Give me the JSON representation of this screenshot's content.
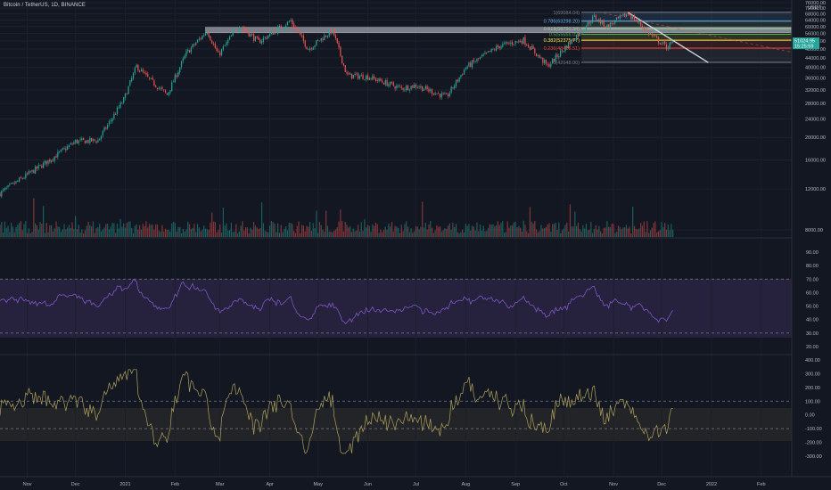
{
  "symbol_title": "Bitcoin / TetherUS, 1D, BINANCE",
  "currency": "USDT",
  "last_price": "51024.95",
  "countdown": "15:25:59",
  "colors": {
    "background": "#131722",
    "up": "#26a69a",
    "down": "#ef5350",
    "rsi": "#7e57c2",
    "cci": "#b0a15b",
    "fib_1": "#787b86",
    "fib_0786": "#64b5f6",
    "fib_0618": "#81c784",
    "fib_05": "#4caf50",
    "fib_0382": "#ffeb3b",
    "fib_0236": "#f44336",
    "fib_0": "#787b86",
    "resistance": "#787b86",
    "trendline": "#d1d4dc"
  },
  "fib_labels": [
    {
      "level": "1",
      "text": "1(69084.04)"
    },
    {
      "level": "0.786",
      "text": "0.786(63298.20)"
    },
    {
      "level": "0.618",
      "text": "0.618(58750.34)"
    },
    {
      "level": "0.5",
      "text": "0.5(55566.02)"
    },
    {
      "level": "0.382",
      "text": "0.382(52375.77)"
    },
    {
      "level": "0.236",
      "text": "0.236(48428.51)"
    },
    {
      "level": "0",
      "text": "0(42048.00)"
    }
  ],
  "chart_data": [
    {
      "type": "candlestick",
      "title": "Bitcoin / TetherUS, 1D, BINANCE",
      "ylabel": "USDT",
      "y_scale": "log",
      "y_ticks": [
        "76000.00",
        "72000.00",
        "68000.00",
        "64000.00",
        "60000.00",
        "56000.00",
        "52000.00",
        "48000.00",
        "44000.00",
        "40000.00",
        "36000.00",
        "32000.00",
        "28000.00",
        "24000.00",
        "20000.00",
        "16000.00",
        "12000.00",
        "8000.00"
      ],
      "x_ticks": [
        "Nov",
        "Dec",
        "2021",
        "Feb",
        "Mar",
        "Apr",
        "May",
        "Jun",
        "Jul",
        "Aug",
        "Sep",
        "Oct",
        "Nov",
        "Dec",
        "2022",
        "Feb"
      ],
      "x_range": [
        "2020-10-15",
        "2022-02-20"
      ],
      "close_series": [
        [
          "2020-10-15",
          11500
        ],
        [
          "2020-11-01",
          13800
        ],
        [
          "2020-11-15",
          16000
        ],
        [
          "2020-12-01",
          19200
        ],
        [
          "2020-12-15",
          19400
        ],
        [
          "2020-12-31",
          29000
        ],
        [
          "2021-01-08",
          40500
        ],
        [
          "2021-01-15",
          36000
        ],
        [
          "2021-01-27",
          30500
        ],
        [
          "2021-02-08",
          46000
        ],
        [
          "2021-02-21",
          57500
        ],
        [
          "2021-02-28",
          45200
        ],
        [
          "2021-03-13",
          61000
        ],
        [
          "2021-03-25",
          51500
        ],
        [
          "2021-04-14",
          63500
        ],
        [
          "2021-04-25",
          48000
        ],
        [
          "2021-05-10",
          58000
        ],
        [
          "2021-05-19",
          37000
        ],
        [
          "2021-06-01",
          36500
        ],
        [
          "2021-06-22",
          32500
        ],
        [
          "2021-07-01",
          33500
        ],
        [
          "2021-07-20",
          29800
        ],
        [
          "2021-08-01",
          40000
        ],
        [
          "2021-08-22",
          49500
        ],
        [
          "2021-09-06",
          52500
        ],
        [
          "2021-09-21",
          40500
        ],
        [
          "2021-10-01",
          48000
        ],
        [
          "2021-10-20",
          66000
        ],
        [
          "2021-10-28",
          60000
        ],
        [
          "2021-11-10",
          68500
        ],
        [
          "2021-11-26",
          54000
        ],
        [
          "2021-12-04",
          49000
        ],
        [
          "2021-12-08",
          51024.95
        ]
      ],
      "annotations": {
        "resistance_zone": [
          56500,
          59500
        ],
        "fibonacci_levels": [
          69084.04,
          63298.2,
          58750.34,
          55566.02,
          52375.77,
          48428.51,
          42048.0
        ]
      }
    },
    {
      "type": "line",
      "title": "",
      "y_ticks": [
        "90.00",
        "80.00",
        "70.00",
        "60.00",
        "50.00",
        "40.00",
        "30.00",
        "20.00"
      ],
      "ylim": [
        20,
        90
      ],
      "bands": [
        30,
        70
      ],
      "oscillator": "rsi"
    },
    {
      "type": "line",
      "title": "",
      "y_ticks": [
        "400.00",
        "300.00",
        "200.00",
        "100.00",
        "0.00",
        "-100.00",
        "-200.00",
        "-300.00"
      ],
      "ylim": [
        -300,
        400
      ],
      "bands": [
        -100,
        100
      ],
      "oscillator": "cci"
    }
  ]
}
